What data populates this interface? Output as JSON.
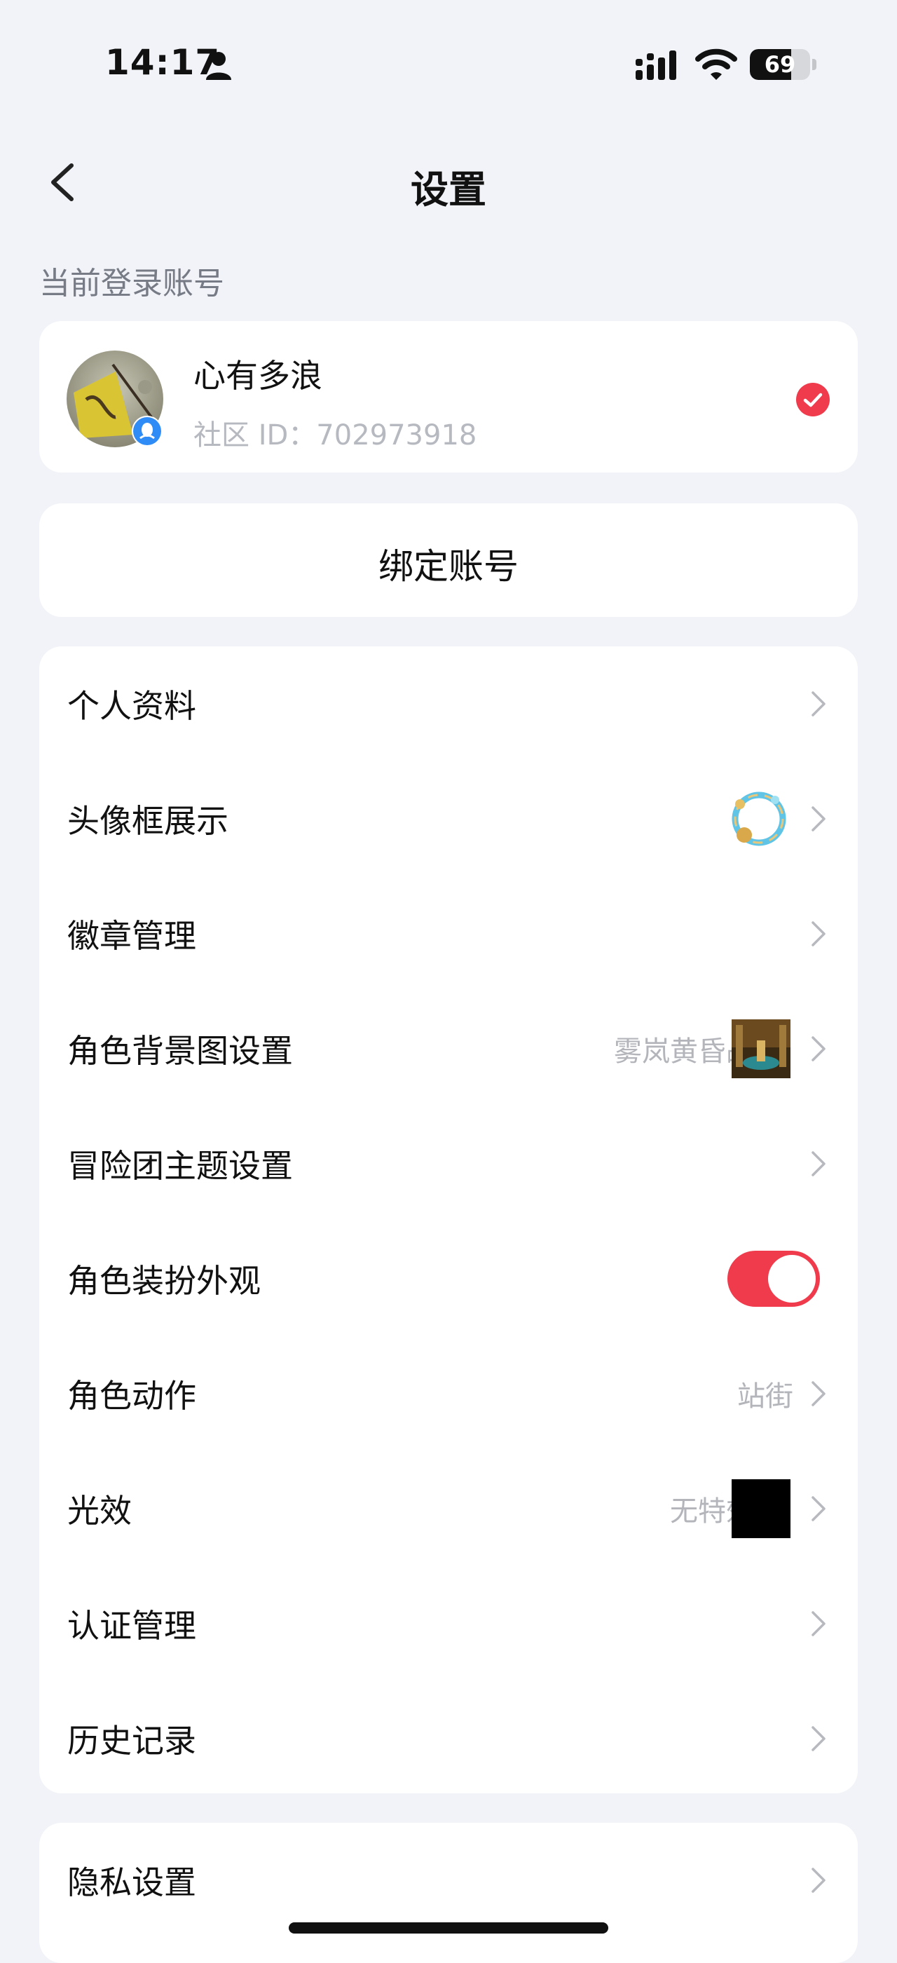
{
  "status_bar": {
    "time": "14:17",
    "battery": "69",
    "battery_level": 0.69,
    "icons": [
      "person-icon",
      "signal-icon",
      "wifi-icon",
      "battery-icon"
    ]
  },
  "header": {
    "title": "设置",
    "back_icon": "chevron-left-icon"
  },
  "account_section": {
    "label": "当前登录账号",
    "name": "心有多浪",
    "id_text": "社区 ID：702973918",
    "selected": true
  },
  "bind_account": {
    "label": "绑定账号"
  },
  "menu": {
    "items": [
      {
        "label": "个人资料"
      },
      {
        "label": "头像框展示"
      },
      {
        "label": "徽章管理"
      },
      {
        "label": "角色背景图设置",
        "value": "雾岚黄昏战"
      },
      {
        "label": "冒险团主题设置"
      },
      {
        "label": "角色装扮外观",
        "toggle_on": true
      },
      {
        "label": "角色动作",
        "value": "站街"
      },
      {
        "label": "光效",
        "value": "无特效"
      },
      {
        "label": "认证管理"
      },
      {
        "label": "历史记录"
      }
    ]
  },
  "privacy": {
    "label": "隐私设置"
  },
  "colors": {
    "background": "#f2f3f8",
    "accent_red": "#ef3b4b",
    "secondary_text": "#b3b5bb"
  }
}
